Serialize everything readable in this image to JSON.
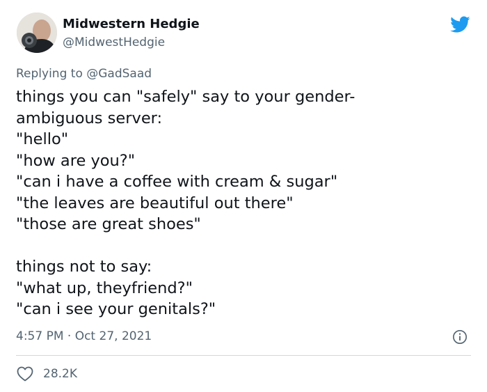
{
  "author": {
    "display_name": "Midwestern Hedgie",
    "handle": "@MidwestHedgie",
    "avatar_icon": "user-avatar-photo"
  },
  "reply": {
    "prefix": "Replying to ",
    "mention": "@GadSaad"
  },
  "tweet": {
    "lines": [
      "things you can \"safely\" say to your gender-",
      "ambiguous server:",
      "\"hello\"",
      "\"how are you?\"",
      "\"can i have a coffee with cream & sugar\"",
      "\"the leaves are beautiful out there\"",
      "\"those are great shoes\"",
      "",
      "things not to say:",
      "\"what up, theyfriend?\"",
      "\"can i see your genitals?\""
    ]
  },
  "meta": {
    "timestamp": "4:57 PM · Oct 27, 2021"
  },
  "stats": {
    "likes": "28.2K"
  },
  "icons": {
    "brand": "twitter-bird-icon",
    "info": "info-icon",
    "like": "heart-icon"
  },
  "colors": {
    "brand_blue": "#1d9bf0",
    "text_primary": "#0f1419",
    "text_secondary": "#536471",
    "divider": "#cfd9de"
  }
}
